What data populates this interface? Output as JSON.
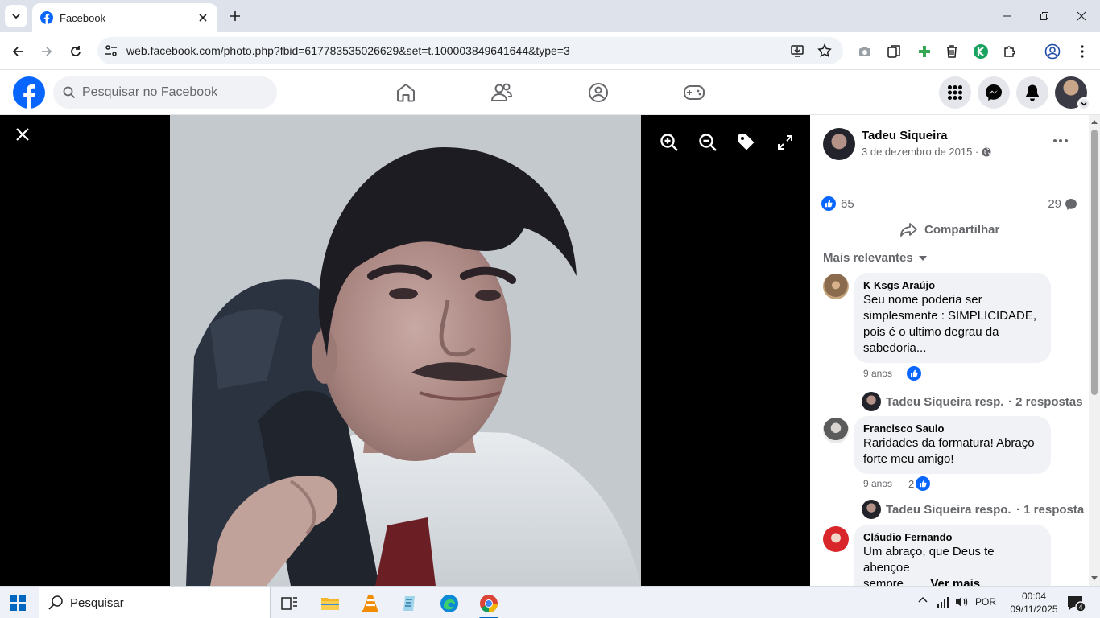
{
  "browser": {
    "tab_title": "Facebook",
    "url": "web.facebook.com/photo.php?fbid=617783535026629&set=t.100003849641644&type=3"
  },
  "fb": {
    "search_placeholder": "Pesquisar no Facebook",
    "brand_color": "#0866ff"
  },
  "post": {
    "author": "Tadeu Siqueira",
    "date": "3 de dezembro de 2015 ·",
    "likes": "65",
    "comments": "29",
    "share_label": "Compartilhar",
    "sort_label": "Mais relevantes"
  },
  "comments": [
    {
      "name": "K Ksgs Araújo",
      "lines": [
        "Seu nome poderia ser",
        "simplesmente : SIMPLICIDADE,",
        "pois é o ultimo degrau da",
        "sabedoria..."
      ],
      "time": "9 anos",
      "like_count": "",
      "reply_name": "Tadeu Siqueira resp...",
      "reply_count": "· 2 respostas"
    },
    {
      "name": "Francisco Saulo",
      "lines": [
        "Raridades da formatura! Abraço",
        "forte meu amigo!"
      ],
      "time": "9 anos",
      "like_count": "2",
      "reply_name": "Tadeu Siqueira respo...",
      "reply_count": "· 1 resposta"
    },
    {
      "name": "Cláudio Fernando",
      "lines": [
        "Um abraço, que Deus te abençoe"
      ],
      "line_last": "sempre... ...",
      "see_more": "Ver mais"
    }
  ],
  "taskbar": {
    "search_placeholder": "Pesquisar",
    "lang": "POR",
    "time": "00:04",
    "date": "09/11/2025",
    "notif_count": "4"
  }
}
